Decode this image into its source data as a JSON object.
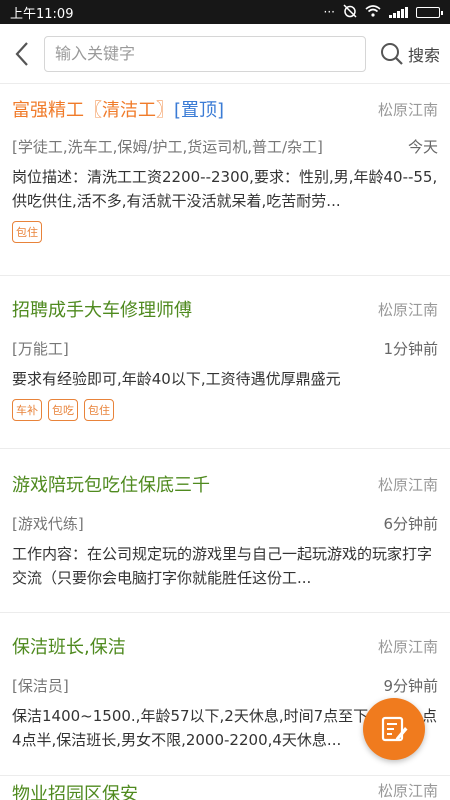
{
  "status": {
    "time": "上午11:09"
  },
  "search": {
    "placeholder": "输入关键字",
    "button_label": "搜索"
  },
  "jobs": [
    {
      "title": "富强精工〖清洁工〗",
      "top_tag": "[置顶]",
      "region": "松原江南",
      "category": "[学徒工,洗车工,保姆/护工,货运司机,普工/杂工]",
      "time": "今天",
      "desc": "岗位描述：清洗工工资2200--2300,要求：性别,男,年龄40--55,供吃供住,活不多,有活就干没活就呆着,吃苦耐劳...",
      "tags": [
        "包住"
      ]
    },
    {
      "title": "招聘成手大车修理师傅",
      "region": "松原江南",
      "category": "[万能工]",
      "time": "1分钟前",
      "desc": "要求有经验即可,年龄40以下,工资待遇优厚鼎盛元",
      "tags": [
        "车补",
        "包吃",
        "包住"
      ]
    },
    {
      "title": "游戏陪玩包吃住保底三千",
      "region": "松原江南",
      "category": "[游戏代练]",
      "time": "6分钟前",
      "desc": "工作内容：在公司规定玩的游戏里与自己一起玩游戏的玩家打字交流（只要你会电脑打字你就能胜任这份工...",
      "tags": []
    },
    {
      "title": "保洁班长,保洁",
      "region": "松原江南",
      "category": "[保洁员]",
      "time": "9分钟前",
      "desc": "保洁1400~1500.,年龄57以下,2天休息,时间7点至下午1点,1点4点半,保洁班长,男女不限,2000-2200,4天休息...",
      "tags": []
    },
    {
      "title": "物业招园区保安",
      "region": "松原江南"
    }
  ],
  "colors": {
    "accent": "#f07b1e",
    "title_green": "#4f8a1f",
    "title_orange": "#f07b2a",
    "top_blue": "#3a7bd5"
  }
}
